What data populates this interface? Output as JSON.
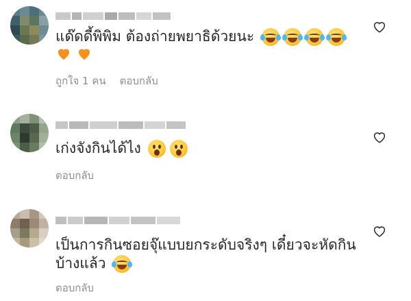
{
  "comments": [
    {
      "text": "แด๊ดดี้พิพิม ต้องถ่ายพยาธิด้วยนะ",
      "likes_label": "ถูกใจ 1 คน",
      "reply_label": "ตอบกลับ",
      "emojis": [
        "face-with-tears-of-joy-icon",
        "face-with-tears-of-joy-icon",
        "face-with-tears-of-joy-icon",
        "face-with-tears-of-joy-icon"
      ],
      "hearts": [
        "orange-heart-icon",
        "orange-heart-icon"
      ]
    },
    {
      "text": "เก่งจังกินได้ไง",
      "reply_label": "ตอบกลับ",
      "emojis": [
        "face-with-open-mouth-icon",
        "face-with-open-mouth-icon"
      ]
    },
    {
      "text_line1": "เป็นการกินซอยจุ๊แบบยกระดับจริงๆ เดี๋ยวจะหัดกิน",
      "text_line2": "บ้างแล้ว",
      "reply_label": "ตอบกลับ",
      "emojis": [
        "face-with-tears-of-joy-icon"
      ]
    }
  ],
  "colors": {
    "text": "#262626",
    "meta": "#8e8e8e",
    "heart_orange": "#f6911e",
    "like_outline": "#262626"
  }
}
